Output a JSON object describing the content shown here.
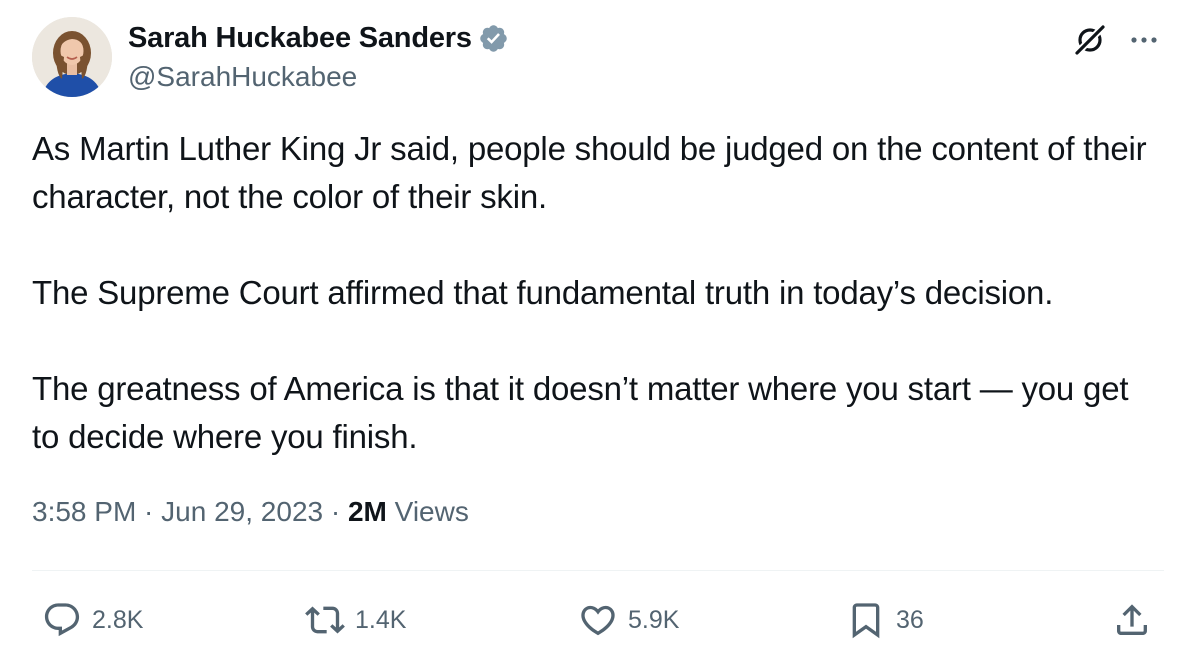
{
  "author": {
    "display_name": "Sarah Huckabee Sanders",
    "handle": "@SarahHuckabee",
    "verified": true,
    "verified_color": "#829aab"
  },
  "tweet": {
    "paragraphs": [
      "As Martin Luther King Jr said, people should be judged on the content of their character, not the color of their skin.",
      "The Supreme Court affirmed that fundamental truth in today’s decision.",
      "The greatness of America is that it doesn’t matter where you start — you get to decide where you finish."
    ]
  },
  "meta": {
    "time": "3:58 PM",
    "separator": " · ",
    "date": "Jun 29, 2023",
    "views_count": "2M",
    "views_label": " Views"
  },
  "actions": {
    "reply": {
      "icon": "reply-icon",
      "count": "2.8K"
    },
    "retweet": {
      "icon": "retweet-icon",
      "count": "1.4K"
    },
    "like": {
      "icon": "heart-icon",
      "count": "5.9K"
    },
    "bookmark": {
      "icon": "bookmark-icon",
      "count": "36"
    },
    "share": {
      "icon": "share-icon"
    }
  },
  "colors": {
    "text_primary": "#0f1419",
    "text_secondary": "#536471",
    "divider": "#eff3f4"
  }
}
